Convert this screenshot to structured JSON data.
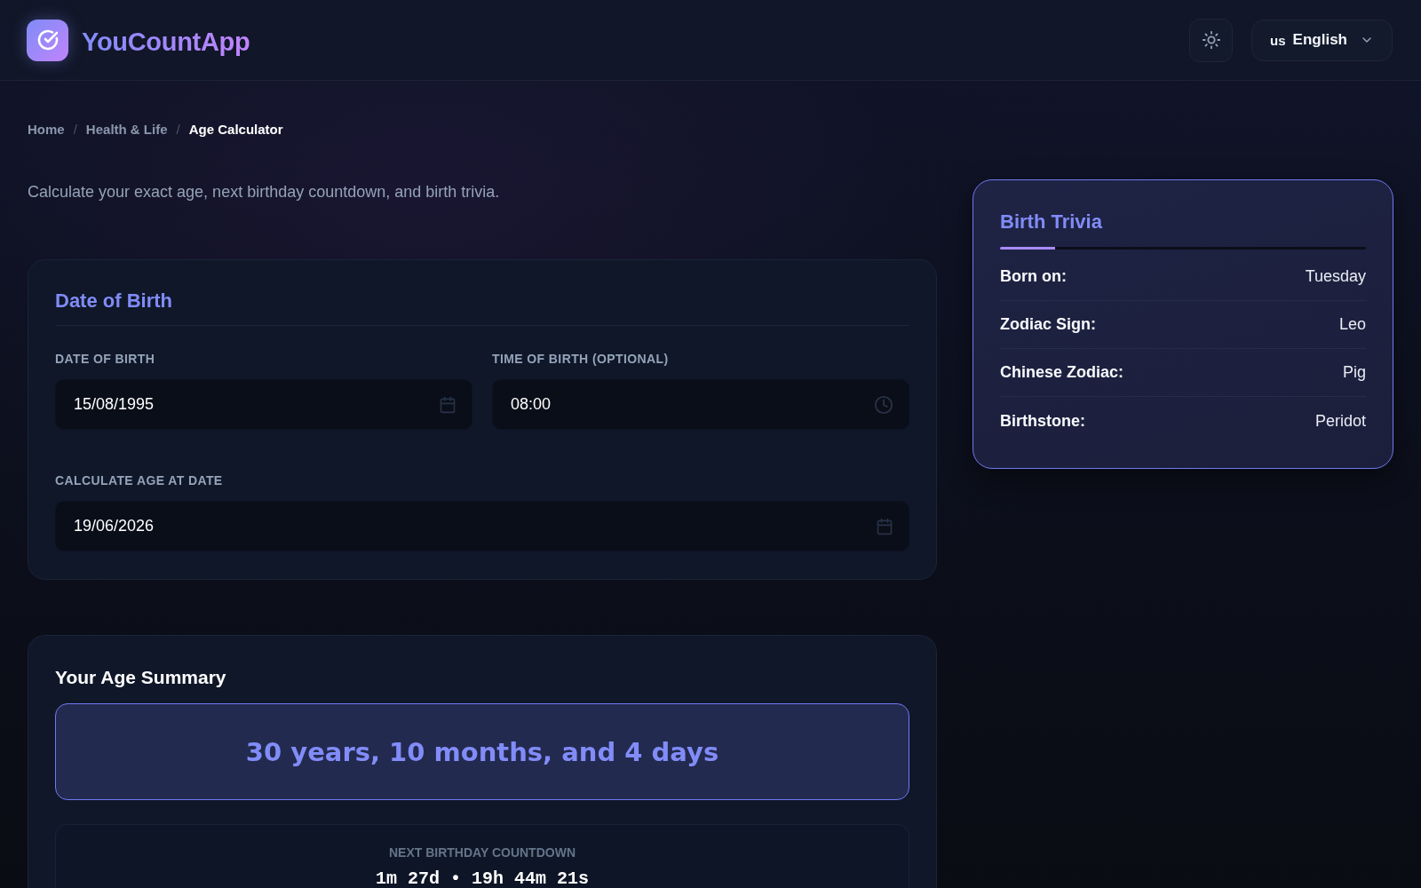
{
  "header": {
    "brand": "YouCountApp",
    "language": {
      "flag": "us",
      "label": "English"
    }
  },
  "breadcrumb": [
    {
      "label": "Home",
      "selected": false
    },
    {
      "label": "Health & Life",
      "selected": false,
      "separator": "/"
    },
    {
      "label": "Age Calculator",
      "selected": true,
      "separator": "/"
    }
  ],
  "description": "Calculate your exact age, next birthday countdown, and birth trivia.",
  "date_card": {
    "title": "Date of Birth",
    "fields": [
      {
        "kind": "date",
        "label": "DATE OF BIRTH",
        "value": "15/08/1995"
      },
      {
        "kind": "time",
        "label": "TIME OF BIRTH (OPTIONAL)",
        "value": "08:00"
      },
      {
        "kind": "date",
        "label": "CALCULATE AGE AT DATE",
        "value": "19/06/2026"
      }
    ]
  },
  "summary": {
    "title": "Your Age Summary",
    "age": "30 years, 10 months, and 4 days",
    "countdown": {
      "label": "NEXT BIRTHDAY COUNTDOWN",
      "value": "1m 27d • 19h 44m 21s"
    }
  },
  "trivia": {
    "title": "Birth Trivia",
    "rows": [
      {
        "label": "Born on:",
        "value": "Tuesday"
      },
      {
        "label": "Zodiac Sign:",
        "value": "Leo"
      },
      {
        "label": "Chinese Zodiac:",
        "value": "Pig"
      },
      {
        "label": "Birthstone:",
        "value": "Peridot"
      }
    ]
  }
}
